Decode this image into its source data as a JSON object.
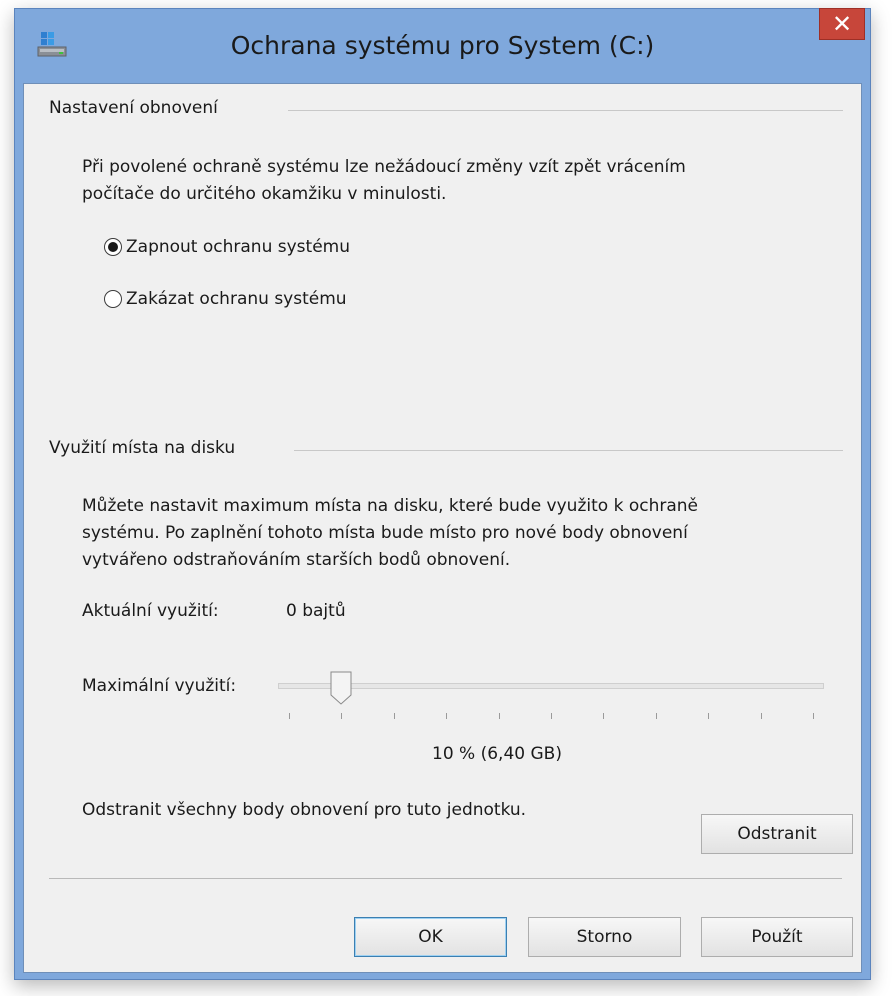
{
  "window": {
    "title": "Ochrana systému pro System (C:)",
    "close_label": "✕",
    "accent_color": "#7fa8dc",
    "close_color": "#c7463a"
  },
  "restore_settings": {
    "header": "Nastavení obnovení",
    "description_line1": "Při povolené ochraně systému lze nežádoucí změny vzít zpět vrácením",
    "description_line2": "počítače do určitého okamžiku v minulosti.",
    "options": [
      {
        "label": "Zapnout ochranu systému",
        "selected": true
      },
      {
        "label": "Zakázat ochranu systému",
        "selected": false
      }
    ]
  },
  "disk_usage": {
    "header": "Využití místa na disku",
    "description_line1": "Můžete nastavit maximum místa na disku, které bude využito k ochraně",
    "description_line2": "systému. Po zaplnění tohoto místa bude místo pro nové body obnovení",
    "description_line3": "vytvářeno odstraňováním starších bodů obnovení.",
    "current_label": "Aktuální využití:",
    "current_value": "0 bajtů",
    "max_label": "Maximální využití:",
    "max_percent": 10,
    "slider_ticks": 11,
    "max_value_text": "10 % (6,40 GB)",
    "delete_text": "Odstranit všechny body obnovení pro tuto jednotku.",
    "delete_button": "Odstranit"
  },
  "footer": {
    "ok": "OK",
    "cancel": "Storno",
    "apply": "Použít"
  }
}
